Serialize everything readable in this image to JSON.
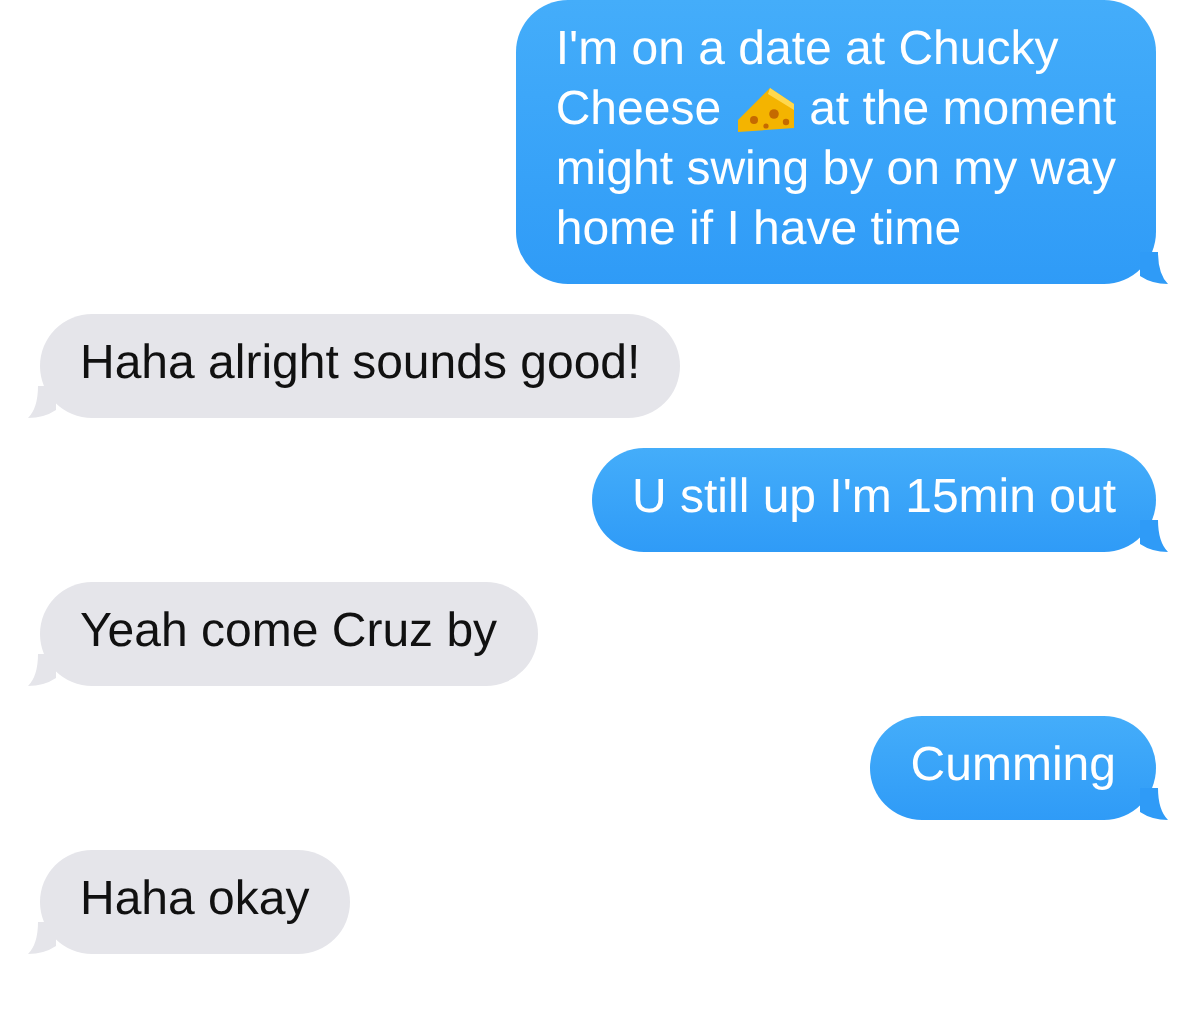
{
  "messages": [
    {
      "kind": "sent",
      "lines": [
        [
          {
            "kind": "text",
            "text": "I'm on a date at Chucky"
          }
        ],
        [
          {
            "kind": "text",
            "text": "Cheese"
          },
          {
            "kind": "emoji"
          },
          {
            "kind": "text",
            "text": "at the moment"
          }
        ],
        [
          {
            "kind": "text",
            "text": "might swing by on my way"
          }
        ],
        [
          {
            "kind": "text",
            "text": "home if I have time"
          }
        ]
      ]
    },
    {
      "kind": "received",
      "lines": [
        [
          {
            "kind": "text",
            "text": "Haha alright sounds good!"
          }
        ]
      ]
    },
    {
      "kind": "sent",
      "lines": [
        [
          {
            "kind": "text",
            "text": "U still up I'm 15min out"
          }
        ]
      ]
    },
    {
      "kind": "received",
      "lines": [
        [
          {
            "kind": "text",
            "text": "Yeah come Cruz by"
          }
        ]
      ]
    },
    {
      "kind": "sent",
      "lines": [
        [
          {
            "kind": "text",
            "text": "Cumming"
          }
        ]
      ]
    },
    {
      "kind": "received",
      "lines": [
        [
          {
            "kind": "text",
            "text": "Haha okay"
          }
        ]
      ]
    }
  ]
}
